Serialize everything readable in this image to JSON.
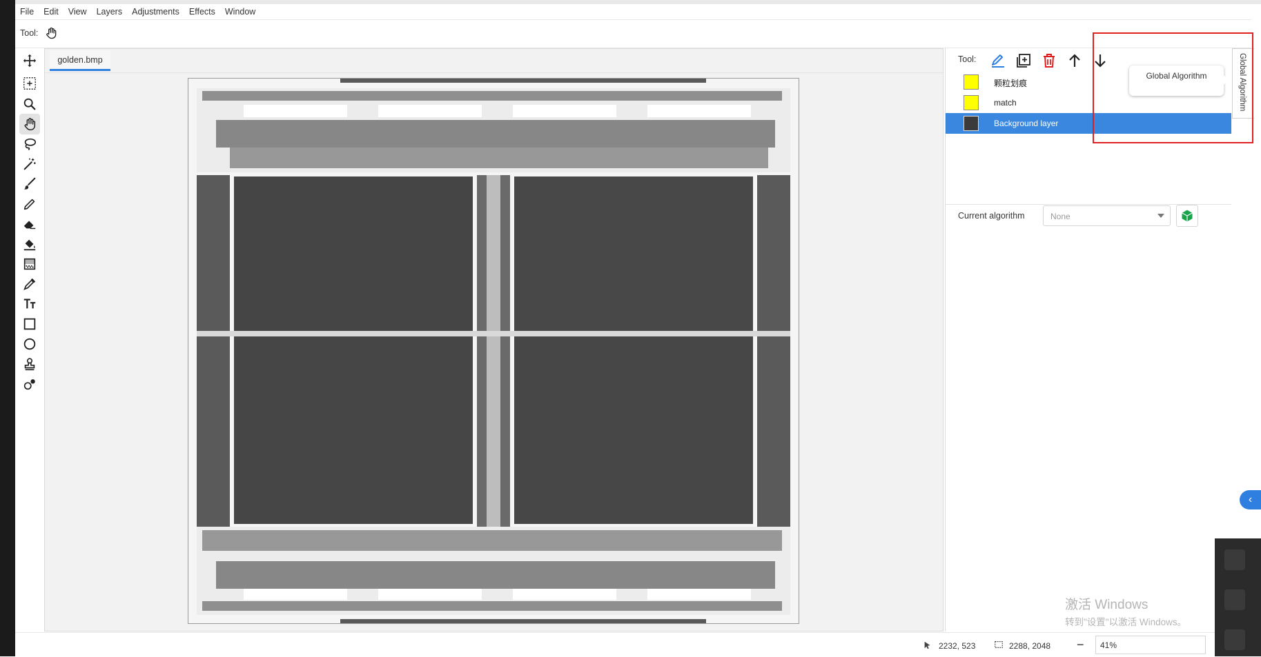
{
  "menu": [
    "File",
    "Edit",
    "View",
    "Layers",
    "Adjustments",
    "Effects",
    "Window"
  ],
  "toolbar": {
    "tool_label": "Tool:"
  },
  "palette": [
    {
      "name": "move-selection-tool"
    },
    {
      "name": "rectangle-select-tool"
    },
    {
      "name": "zoom-tool"
    },
    {
      "name": "pan-tool",
      "active": true
    },
    {
      "name": "lasso-select-tool"
    },
    {
      "name": "magic-wand-tool"
    },
    {
      "name": "paintbrush-tool"
    },
    {
      "name": "pencil-tool"
    },
    {
      "name": "eraser-tool"
    },
    {
      "name": "paint-bucket-tool"
    },
    {
      "name": "gradient-tool"
    },
    {
      "name": "color-picker-tool"
    },
    {
      "name": "text-tool"
    },
    {
      "name": "rectangle-tool"
    },
    {
      "name": "ellipse-tool"
    },
    {
      "name": "clone-stamp-tool"
    },
    {
      "name": "recolor-tool"
    }
  ],
  "document": {
    "tab_name": "golden.bmp"
  },
  "layers_panel": {
    "tool_label": "Tool:",
    "layers": [
      {
        "name": "颗粒划痕",
        "thumb_color": "#ffff00",
        "selected": false
      },
      {
        "name": "match",
        "thumb_color": "#ffff00",
        "selected": false
      },
      {
        "name": "Background layer",
        "thumb_color": "#3b3b3b",
        "selected": true
      }
    ],
    "accent_color": "#3a87e0"
  },
  "algorithm": {
    "label": "Current algorithm",
    "selected": "None"
  },
  "dock": {
    "global_algorithm": "Global Algorithm",
    "tooltip": "Global Algorithm"
  },
  "status": {
    "cursor_position": "2232, 523",
    "selection_size": "2288, 2048",
    "zoom": "41%"
  },
  "watermark": {
    "title": "激活 Windows",
    "subtitle": "转到\"设置\"以激活 Windows。"
  }
}
